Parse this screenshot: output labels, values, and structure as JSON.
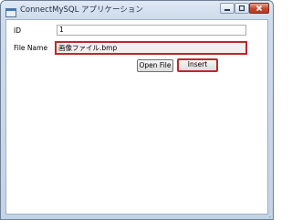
{
  "window": {
    "title": "ConnectMySQL アプリケーション"
  },
  "form": {
    "id_label": "ID",
    "id_value": "1",
    "filename_label": "File Name",
    "filename_value": "画像ファイル.bmp"
  },
  "buttons": {
    "open_file": "Open File",
    "insert": "Insert"
  },
  "icons": {
    "app": "app-icon",
    "minimize": "minimize-icon",
    "maximize": "maximize-icon",
    "close": "close-icon",
    "resize_grip": "resize-grip-icon"
  },
  "colors": {
    "highlight": "#c1272d",
    "close_button": "#c7452c"
  }
}
